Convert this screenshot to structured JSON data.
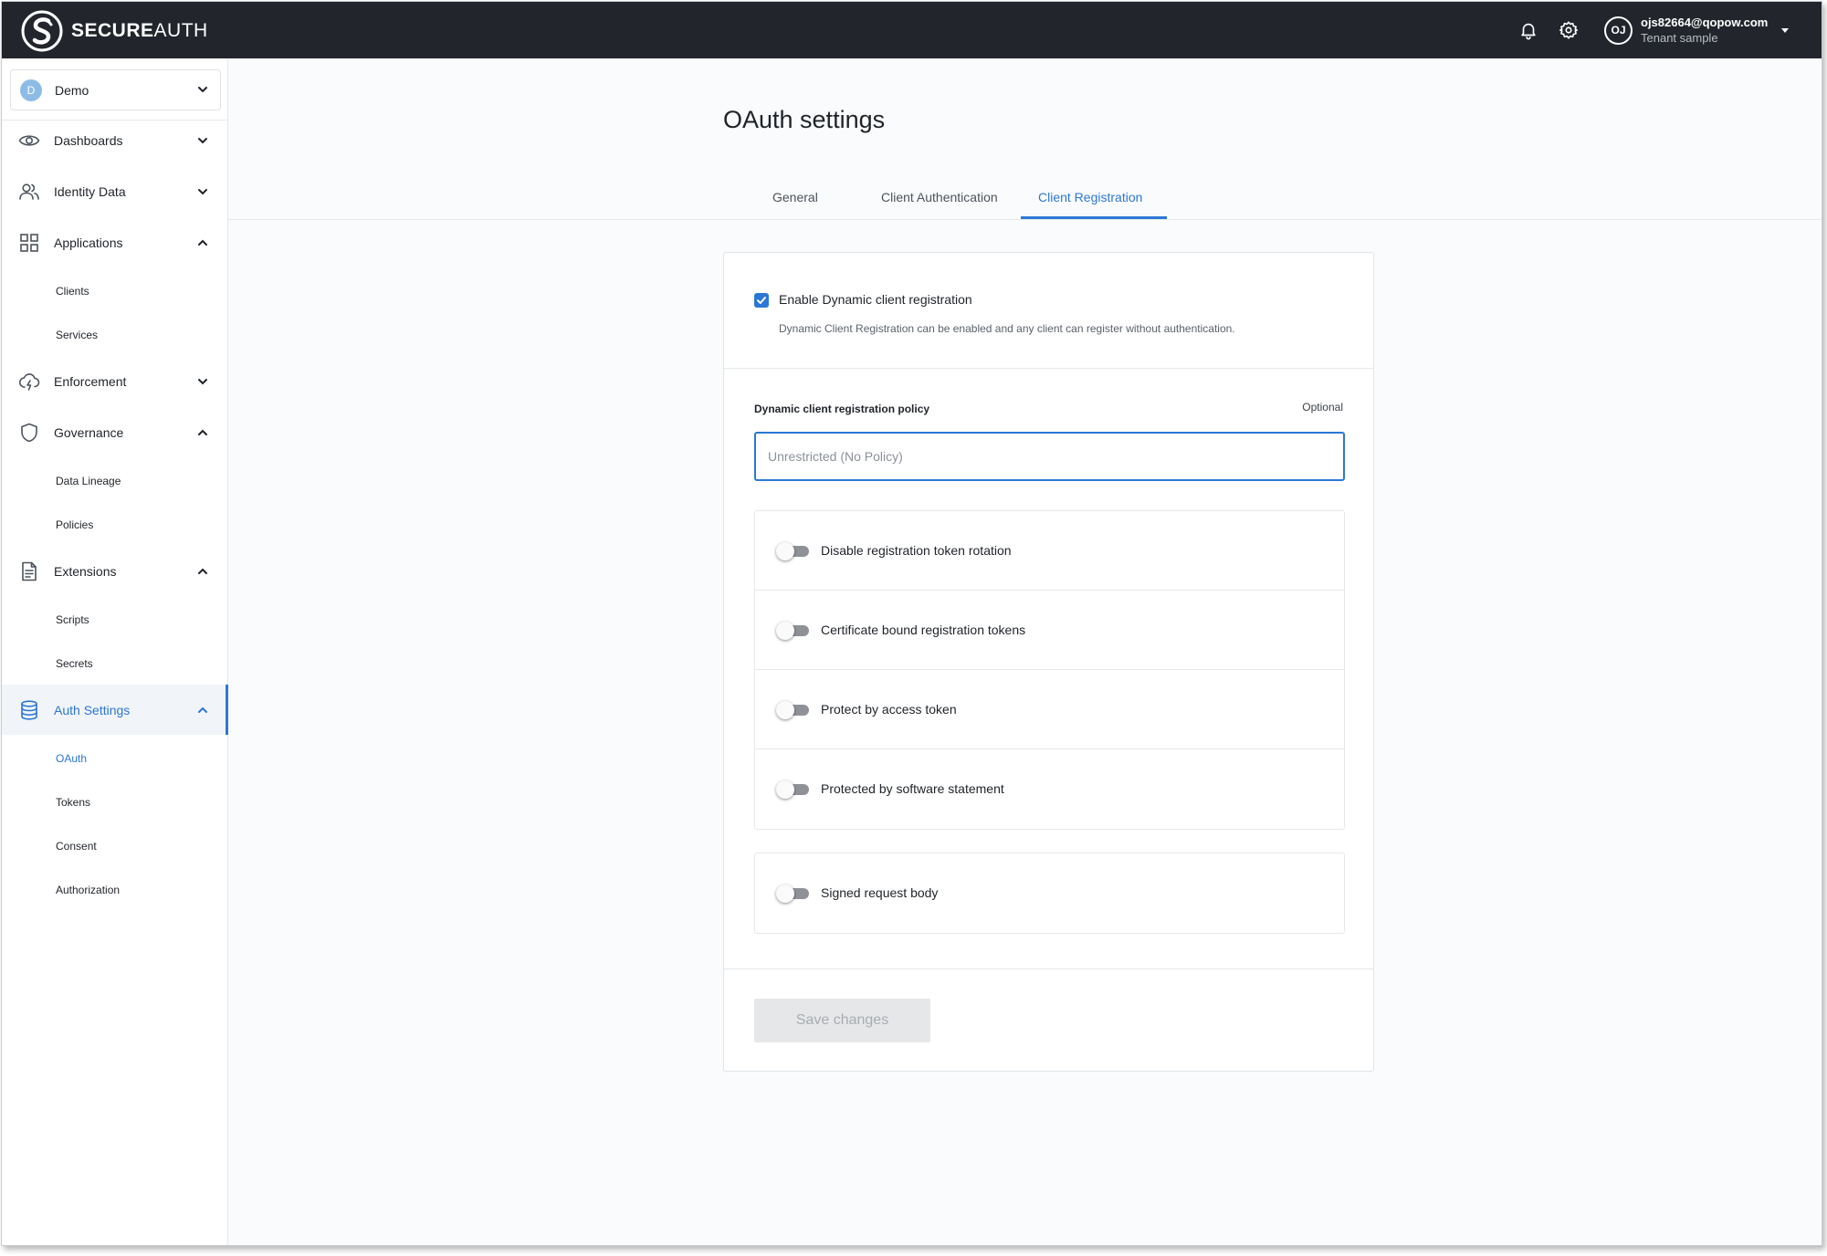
{
  "topbar": {
    "brand_bold": "SECURE",
    "brand_light": "AUTH",
    "user_initials": "OJ",
    "user_email": "ojs82664@qopow.com",
    "user_tenant": "Tenant sample"
  },
  "sidebar": {
    "tenant_initial": "D",
    "tenant_name": "Demo",
    "items": [
      {
        "label": "Dashboards",
        "icon": "eye-icon"
      },
      {
        "label": "Identity Data",
        "icon": "users-icon"
      },
      {
        "label": "Applications",
        "icon": "grid-icon",
        "children": [
          "Clients",
          "Services"
        ]
      },
      {
        "label": "Enforcement",
        "icon": "cloud-bolt-icon"
      },
      {
        "label": "Governance",
        "icon": "shield-icon",
        "children": [
          "Data Lineage",
          "Policies"
        ]
      },
      {
        "label": "Extensions",
        "icon": "document-icon",
        "children": [
          "Scripts",
          "Secrets"
        ]
      },
      {
        "label": "Auth Settings",
        "icon": "database-icon",
        "active": true,
        "children": [
          "OAuth",
          "Tokens",
          "Consent",
          "Authorization"
        ],
        "active_child": "OAuth"
      }
    ]
  },
  "main": {
    "title": "OAuth settings",
    "tabs": [
      {
        "label": "General",
        "active": false
      },
      {
        "label": "Client Authentication",
        "active": false
      },
      {
        "label": "Client Registration",
        "active": true
      }
    ],
    "dynamic_registration": {
      "checkbox_label": "Enable Dynamic client registration",
      "checked": true,
      "help_text": "Dynamic Client Registration can be enabled and any client can register without authentication."
    },
    "policy": {
      "label": "Dynamic client registration policy",
      "optional": "Optional",
      "placeholder": "Unrestricted (No Policy)",
      "value": ""
    },
    "toggles": [
      {
        "label": "Disable registration token rotation",
        "on": false
      },
      {
        "label": "Certificate bound registration tokens",
        "on": false
      },
      {
        "label": "Protect by access token",
        "on": false
      },
      {
        "label": "Protected by software statement",
        "on": false
      }
    ],
    "toggles_extra": [
      {
        "label": "Signed request body",
        "on": false
      }
    ],
    "save_label": "Save changes"
  },
  "colors": {
    "accent": "#2c77d6",
    "topbar": "#22262c",
    "disabled_button": "#e6e7e9"
  }
}
